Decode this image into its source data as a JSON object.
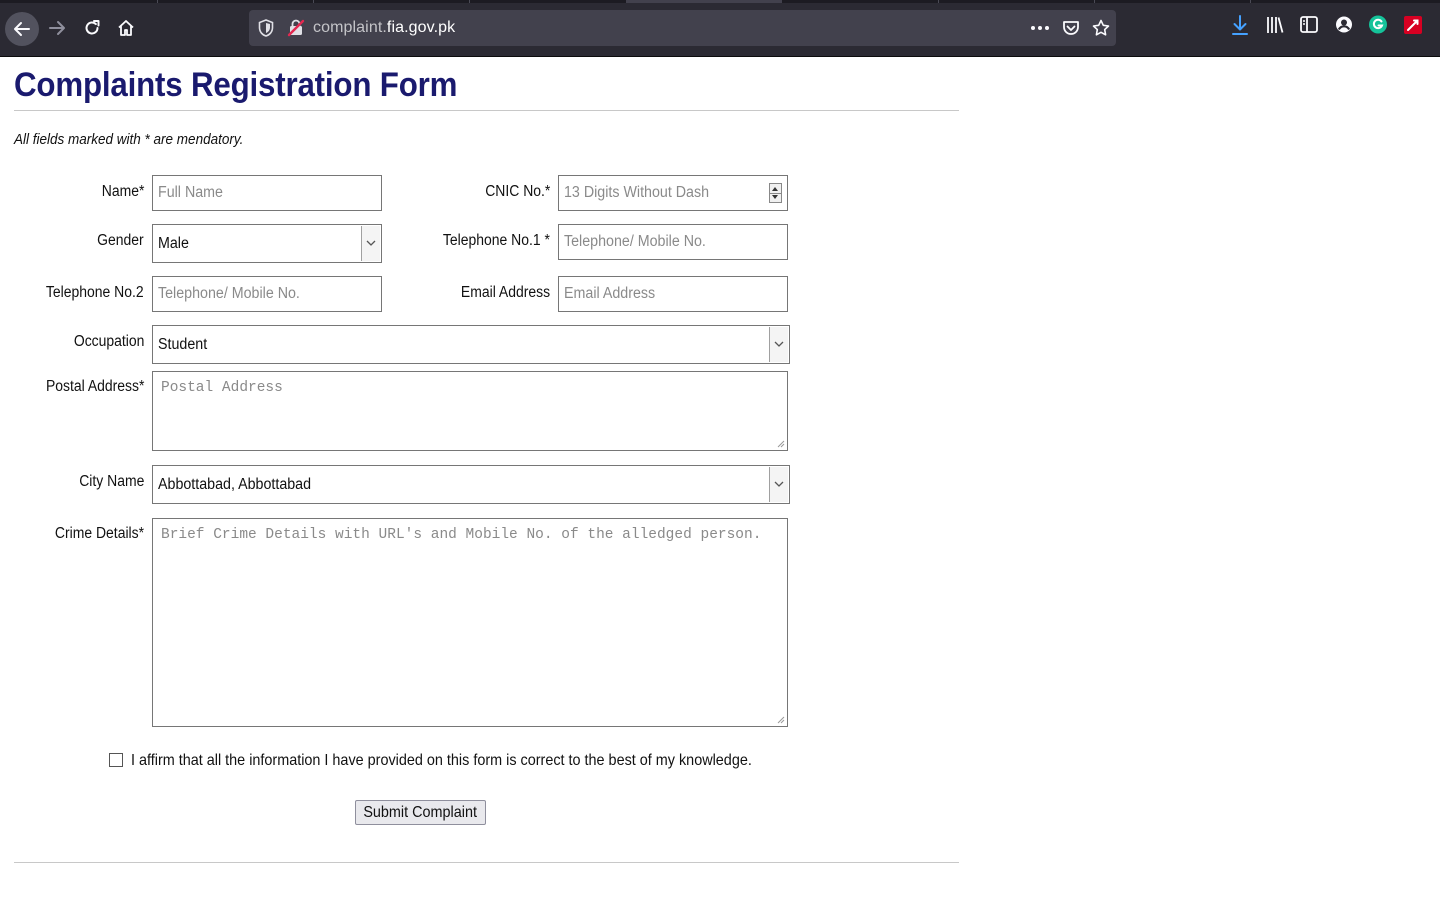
{
  "browser": {
    "url_prefix": "complaint.",
    "url_domain": "fia.gov.pk",
    "icons": {
      "back": "arrow-left-icon",
      "forward": "arrow-right-icon",
      "reload": "reload-icon",
      "home": "home-icon",
      "more": "ellipsis-icon",
      "pocket": "pocket-icon",
      "bookmark": "star-icon",
      "download": "download-icon",
      "library": "library-icon",
      "sidebar": "sidebar-icon",
      "account": "account-icon",
      "grammarly": "grammarly-icon",
      "extension": "extension-icon"
    },
    "accent_download": "#45a1ff",
    "accent_grammarly": "#15c39a",
    "accent_extension": "#d70022"
  },
  "page": {
    "title": "Complaints Registration Form",
    "title_color": "#1a1a6e",
    "mandatory_note": "All fields marked with * are mendatory."
  },
  "form": {
    "name": {
      "label": "Name*",
      "placeholder": "Full Name"
    },
    "cnic": {
      "label": "CNIC No.*",
      "placeholder": "13 Digits Without Dash"
    },
    "gender": {
      "label": "Gender",
      "value": "Male"
    },
    "telephone1": {
      "label": "Telephone No.1 *",
      "placeholder": "Telephone/ Mobile No."
    },
    "telephone2": {
      "label": "Telephone No.2",
      "placeholder": "Telephone/ Mobile No."
    },
    "email": {
      "label": "Email Address",
      "placeholder": "Email Address"
    },
    "occupation": {
      "label": "Occupation",
      "value": "Student"
    },
    "postal_address": {
      "label": "Postal Address*",
      "placeholder": "Postal Address"
    },
    "city": {
      "label": "City Name",
      "value": "Abbottabad, Abbottabad"
    },
    "crime_details": {
      "label": "Crime Details*",
      "placeholder": "Brief Crime Details with URL's and Mobile No. of the alledged person."
    },
    "affirm": {
      "label": "I affirm that all the information I have provided on this form is correct to the best of my knowledge."
    },
    "submit_label": "Submit Complaint"
  }
}
